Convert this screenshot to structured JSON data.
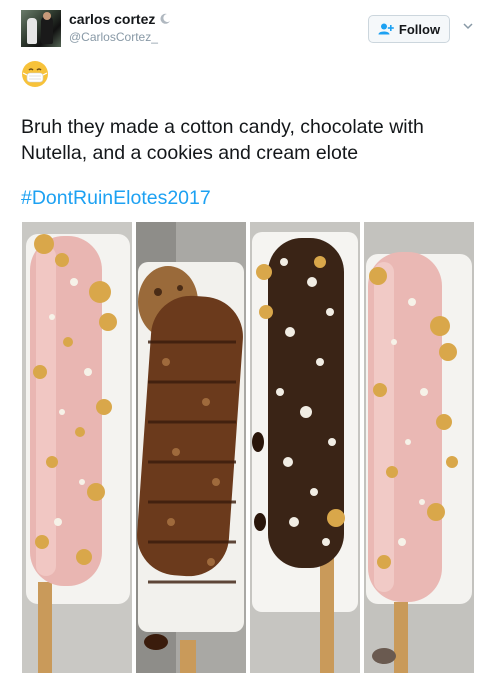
{
  "header": {
    "display_name": "carlos cortez",
    "handle": "@CarlosCortez_",
    "follow_label": "Follow"
  },
  "tweet": {
    "text": "Bruh they made a cotton candy, chocolate with Nutella, and a cookies and cream elote",
    "hashtag": "#DontRuinElotes2017"
  },
  "icons": {
    "name_badge": "crescent-moon-icon",
    "follow": "add-user-icon",
    "menu": "chevron-down-icon",
    "emoji": "face-with-medical-mask-emoji"
  },
  "colors": {
    "link": "#1da1f2",
    "text": "#14171a",
    "muted": "#8899a6"
  }
}
